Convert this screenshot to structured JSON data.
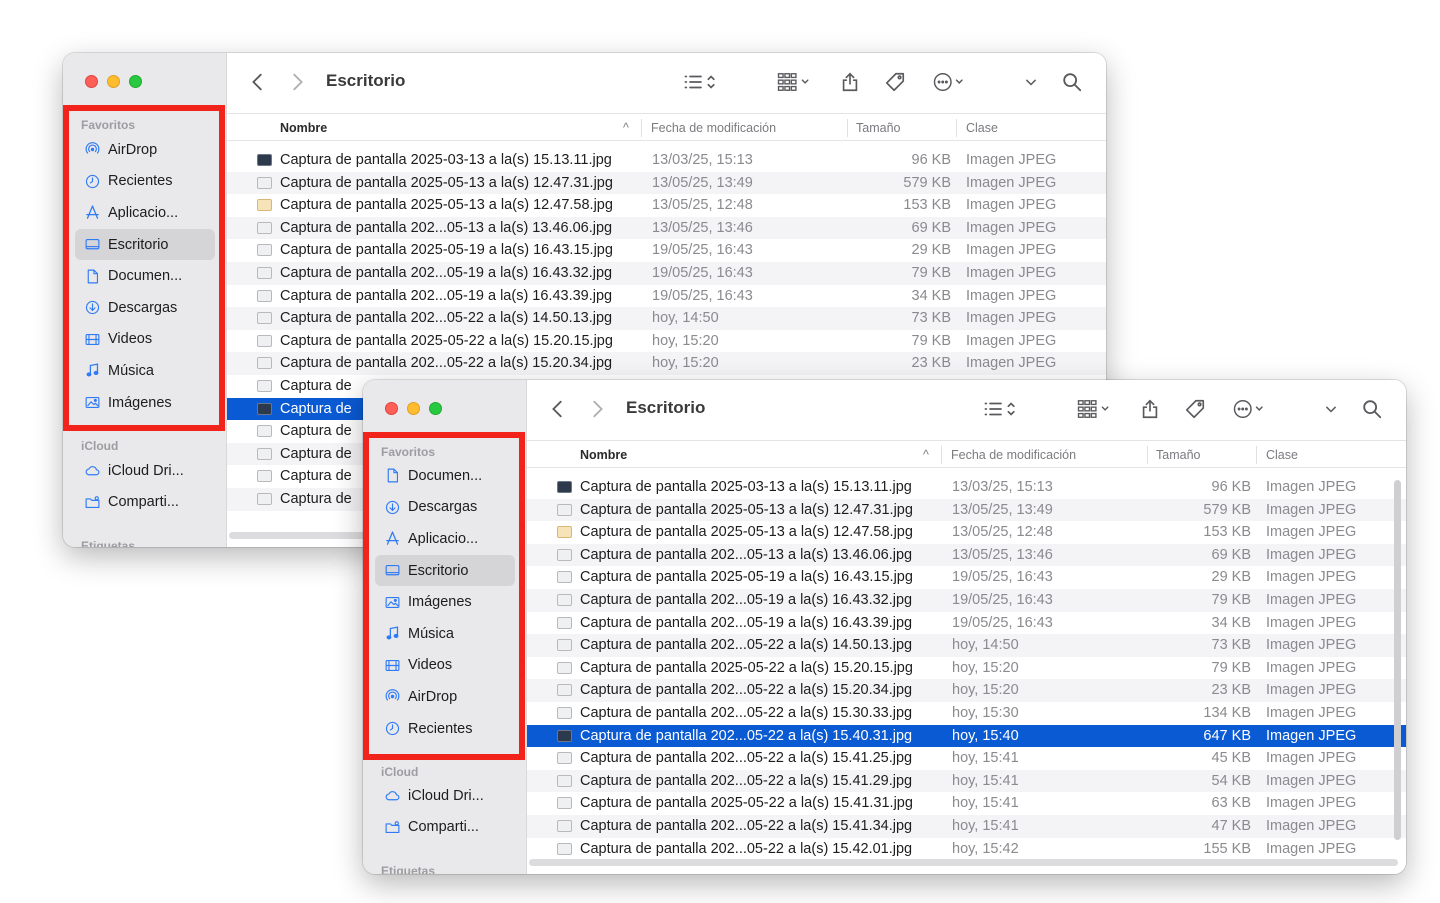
{
  "colors": {
    "accent": "#2f7bf5",
    "selection": "#0a5ad4",
    "highlight_box": "#f2231a"
  },
  "back_window": {
    "title": "Escritorio",
    "sidebar": {
      "favorites_label": "Favoritos",
      "items": [
        {
          "label": "AirDrop",
          "icon": "airdrop-icon"
        },
        {
          "label": "Recientes",
          "icon": "clock-icon"
        },
        {
          "label": "Aplicacio...",
          "icon": "apps-icon"
        },
        {
          "label": "Escritorio",
          "icon": "desktop-icon",
          "selected": true
        },
        {
          "label": "Documen...",
          "icon": "document-icon"
        },
        {
          "label": "Descargas",
          "icon": "download-icon"
        },
        {
          "label": "Videos",
          "icon": "film-icon"
        },
        {
          "label": "Música",
          "icon": "music-icon"
        },
        {
          "label": "Imágenes",
          "icon": "photo-icon"
        }
      ],
      "icloud_label": "iCloud",
      "icloud_items": [
        {
          "label": "iCloud Dri...",
          "icon": "cloud-icon"
        },
        {
          "label": "Comparti...",
          "icon": "shared-folder-icon"
        }
      ],
      "tags_label": "Etiquetas"
    },
    "columns": {
      "name": "Nombre",
      "date": "Fecha de modificación",
      "size": "Tamaño",
      "kind": "Clase"
    },
    "files": [
      {
        "name": "Captura de pantalla 2025-03-13 a la(s) 15.13.11.jpg",
        "date": "13/03/25, 15:13",
        "size": "96 KB",
        "kind": "Imagen JPEG",
        "thumb": "dark"
      },
      {
        "name": "Captura de pantalla 2025-05-13 a la(s) 12.47.31.jpg",
        "date": "13/05/25, 13:49",
        "size": "579 KB",
        "kind": "Imagen JPEG",
        "thumb": "light"
      },
      {
        "name": "Captura de pantalla 2025-05-13 a la(s) 12.47.58.jpg",
        "date": "13/05/25, 12:48",
        "size": "153 KB",
        "kind": "Imagen JPEG",
        "thumb": "warm"
      },
      {
        "name": "Captura de pantalla 202...05-13 a la(s) 13.46.06.jpg",
        "date": "13/05/25, 13:46",
        "size": "69 KB",
        "kind": "Imagen JPEG",
        "thumb": "light"
      },
      {
        "name": "Captura de pantalla 2025-05-19 a la(s) 16.43.15.jpg",
        "date": "19/05/25, 16:43",
        "size": "29 KB",
        "kind": "Imagen JPEG",
        "thumb": "light"
      },
      {
        "name": "Captura de pantalla 202...05-19 a la(s) 16.43.32.jpg",
        "date": "19/05/25, 16:43",
        "size": "79 KB",
        "kind": "Imagen JPEG",
        "thumb": "light"
      },
      {
        "name": "Captura de pantalla 202...05-19 a la(s) 16.43.39.jpg",
        "date": "19/05/25, 16:43",
        "size": "34 KB",
        "kind": "Imagen JPEG",
        "thumb": "light"
      },
      {
        "name": "Captura de pantalla 202...05-22 a la(s) 14.50.13.jpg",
        "date": "hoy, 14:50",
        "size": "73 KB",
        "kind": "Imagen JPEG",
        "thumb": "light"
      },
      {
        "name": "Captura de pantalla 2025-05-22 a la(s) 15.20.15.jpg",
        "date": "hoy, 15:20",
        "size": "79 KB",
        "kind": "Imagen JPEG",
        "thumb": "light"
      },
      {
        "name": "Captura de pantalla 202...05-22 a la(s) 15.20.34.jpg",
        "date": "hoy, 15:20",
        "size": "23 KB",
        "kind": "Imagen JPEG",
        "thumb": "light"
      },
      {
        "name": "Captura de",
        "date": "",
        "size": "",
        "kind": "",
        "thumb": "light"
      },
      {
        "name": "Captura de",
        "date": "",
        "size": "",
        "kind": "",
        "thumb": "dark",
        "selected": true
      },
      {
        "name": "Captura de",
        "date": "",
        "size": "",
        "kind": "",
        "thumb": "light"
      },
      {
        "name": "Captura de",
        "date": "",
        "size": "",
        "kind": "",
        "thumb": "light"
      },
      {
        "name": "Captura de",
        "date": "",
        "size": "",
        "kind": "",
        "thumb": "light"
      },
      {
        "name": "Captura de",
        "date": "",
        "size": "",
        "kind": "",
        "thumb": "light"
      }
    ]
  },
  "front_window": {
    "title": "Escritorio",
    "sidebar": {
      "favorites_label": "Favoritos",
      "items": [
        {
          "label": "Documen...",
          "icon": "document-icon"
        },
        {
          "label": "Descargas",
          "icon": "download-icon"
        },
        {
          "label": "Aplicacio...",
          "icon": "apps-icon"
        },
        {
          "label": "Escritorio",
          "icon": "desktop-icon",
          "selected": true
        },
        {
          "label": "Imágenes",
          "icon": "photo-icon"
        },
        {
          "label": "Música",
          "icon": "music-icon"
        },
        {
          "label": "Videos",
          "icon": "film-icon"
        },
        {
          "label": "AirDrop",
          "icon": "airdrop-icon"
        },
        {
          "label": "Recientes",
          "icon": "clock-icon"
        }
      ],
      "icloud_label": "iCloud",
      "icloud_items": [
        {
          "label": "iCloud Dri...",
          "icon": "cloud-icon"
        },
        {
          "label": "Comparti...",
          "icon": "shared-folder-icon"
        }
      ],
      "tags_label": "Etiquetas"
    },
    "columns": {
      "name": "Nombre",
      "date": "Fecha de modificación",
      "size": "Tamaño",
      "kind": "Clase"
    },
    "files": [
      {
        "name": "Captura de pantalla 2025-03-13 a la(s) 15.13.11.jpg",
        "date": "13/03/25, 15:13",
        "size": "96 KB",
        "kind": "Imagen JPEG",
        "thumb": "dark"
      },
      {
        "name": "Captura de pantalla 2025-05-13 a la(s) 12.47.31.jpg",
        "date": "13/05/25, 13:49",
        "size": "579 KB",
        "kind": "Imagen JPEG",
        "thumb": "light"
      },
      {
        "name": "Captura de pantalla 2025-05-13 a la(s) 12.47.58.jpg",
        "date": "13/05/25, 12:48",
        "size": "153 KB",
        "kind": "Imagen JPEG",
        "thumb": "warm"
      },
      {
        "name": "Captura de pantalla 202...05-13 a la(s) 13.46.06.jpg",
        "date": "13/05/25, 13:46",
        "size": "69 KB",
        "kind": "Imagen JPEG",
        "thumb": "light"
      },
      {
        "name": "Captura de pantalla 2025-05-19 a la(s) 16.43.15.jpg",
        "date": "19/05/25, 16:43",
        "size": "29 KB",
        "kind": "Imagen JPEG",
        "thumb": "light"
      },
      {
        "name": "Captura de pantalla 202...05-19 a la(s) 16.43.32.jpg",
        "date": "19/05/25, 16:43",
        "size": "79 KB",
        "kind": "Imagen JPEG",
        "thumb": "light"
      },
      {
        "name": "Captura de pantalla 202...05-19 a la(s) 16.43.39.jpg",
        "date": "19/05/25, 16:43",
        "size": "34 KB",
        "kind": "Imagen JPEG",
        "thumb": "light"
      },
      {
        "name": "Captura de pantalla 202...05-22 a la(s) 14.50.13.jpg",
        "date": "hoy, 14:50",
        "size": "73 KB",
        "kind": "Imagen JPEG",
        "thumb": "light"
      },
      {
        "name": "Captura de pantalla 2025-05-22 a la(s) 15.20.15.jpg",
        "date": "hoy, 15:20",
        "size": "79 KB",
        "kind": "Imagen JPEG",
        "thumb": "light"
      },
      {
        "name": "Captura de pantalla 202...05-22 a la(s) 15.20.34.jpg",
        "date": "hoy, 15:20",
        "size": "23 KB",
        "kind": "Imagen JPEG",
        "thumb": "light"
      },
      {
        "name": "Captura de pantalla 202...05-22 a la(s) 15.30.33.jpg",
        "date": "hoy, 15:30",
        "size": "134 KB",
        "kind": "Imagen JPEG",
        "thumb": "light"
      },
      {
        "name": "Captura de pantalla 202...05-22 a la(s) 15.40.31.jpg",
        "date": "hoy, 15:40",
        "size": "647 KB",
        "kind": "Imagen JPEG",
        "thumb": "dark",
        "selected": true
      },
      {
        "name": "Captura de pantalla 202...05-22 a la(s) 15.41.25.jpg",
        "date": "hoy, 15:41",
        "size": "45 KB",
        "kind": "Imagen JPEG",
        "thumb": "light"
      },
      {
        "name": "Captura de pantalla 202...05-22 a la(s) 15.41.29.jpg",
        "date": "hoy, 15:41",
        "size": "54 KB",
        "kind": "Imagen JPEG",
        "thumb": "light"
      },
      {
        "name": "Captura de pantalla 2025-05-22 a la(s) 15.41.31.jpg",
        "date": "hoy, 15:41",
        "size": "63 KB",
        "kind": "Imagen JPEG",
        "thumb": "light"
      },
      {
        "name": "Captura de pantalla 202...05-22 a la(s) 15.41.34.jpg",
        "date": "hoy, 15:41",
        "size": "47 KB",
        "kind": "Imagen JPEG",
        "thumb": "light"
      },
      {
        "name": "Captura de pantalla 202...05-22 a la(s) 15.42.01.jpg",
        "date": "hoy, 15:42",
        "size": "155 KB",
        "kind": "Imagen JPEG",
        "thumb": "light"
      }
    ]
  }
}
